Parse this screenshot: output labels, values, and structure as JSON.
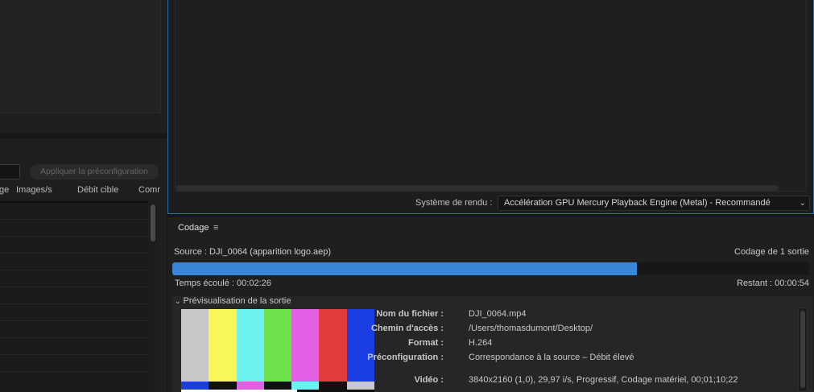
{
  "left": {
    "apply_preset_label": "Appliquer la préconfiguration",
    "columns": [
      "ge",
      "Images/s",
      "Débit cible",
      "Comr"
    ]
  },
  "renderer": {
    "label": "Système de rendu :",
    "value": "Accélération GPU Mercury Playback Engine (Metal) - Recommandé"
  },
  "encoding": {
    "title": "Codage",
    "source": "Source : DJI_0064 (apparition logo.aep)",
    "output_count": "Codage de 1 sortie",
    "progress_fraction": 0.73,
    "elapsed": "Temps écoulé : 00:02:26",
    "remaining": "Restant : 00:00:54",
    "preview_header": "Prévisualisation de la sortie",
    "info": [
      {
        "label": "Nom du fichier :",
        "value": "DJI_0064.mp4"
      },
      {
        "label": "Chemin d'accès :",
        "value": "/Users/thomasdumont/Desktop/"
      },
      {
        "label": "Format :",
        "value": "H.264"
      },
      {
        "label": "Préconfiguration :",
        "value": "Correspondance à la source – Débit élevé"
      },
      {
        "label": "Vidéo :",
        "value": "3840x2160 (1,0), 29,97 i/s, Progressif, Codage matériel, 00;01;10;22"
      }
    ]
  },
  "colors": {
    "accent": "#3a86d8",
    "bars_main": [
      "#c8c8c8",
      "#f7f75a",
      "#6cf0f0",
      "#6ee14a",
      "#e25ee3",
      "#e23c3c",
      "#1a3ee3"
    ],
    "bars_mid": [
      "#1a3ee3",
      "#101010",
      "#e25ee3",
      "#101010",
      "#6cf0f0",
      "#101010",
      "#c8c8c8"
    ]
  }
}
